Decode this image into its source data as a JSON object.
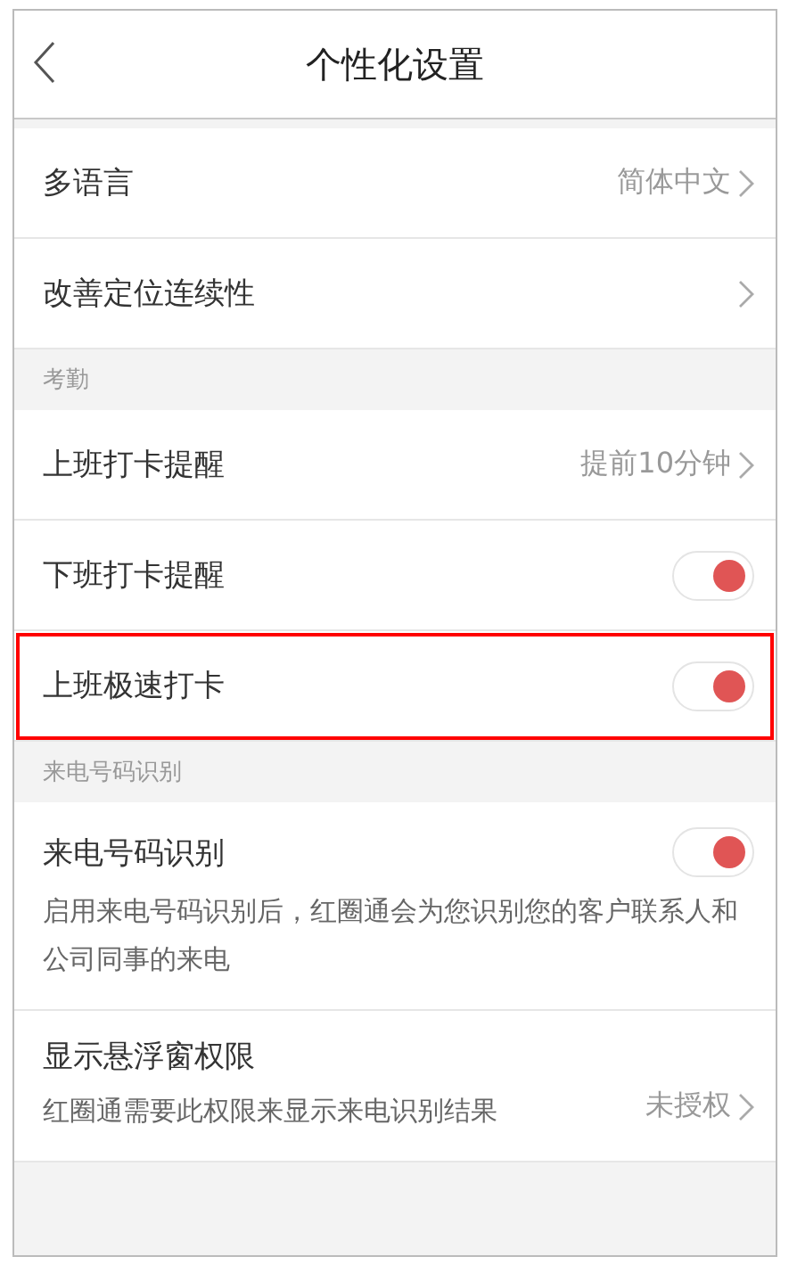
{
  "header": {
    "title": "个性化设置"
  },
  "sections": [
    {
      "items": [
        {
          "kind": "value",
          "label": "多语言",
          "value": "简体中文",
          "highlighted": false
        },
        {
          "kind": "link",
          "label": "改善定位连续性",
          "highlighted": false
        }
      ]
    },
    {
      "title": "考勤",
      "items": [
        {
          "kind": "value",
          "label": "上班打卡提醒",
          "value": "提前10分钟",
          "highlighted": false
        },
        {
          "kind": "toggle",
          "label": "下班打卡提醒",
          "on": true,
          "highlighted": false
        },
        {
          "kind": "toggle",
          "label": "上班极速打卡",
          "on": true,
          "highlighted": true
        }
      ]
    },
    {
      "title": "来电号码识别",
      "items": [
        {
          "kind": "toggle",
          "label": "来电号码识别",
          "on": true,
          "description": "启用来电号码识别后，红圈通会为您识别您的客户联系人和公司同事的来电",
          "highlighted": false
        },
        {
          "kind": "permission",
          "label": "显示悬浮窗权限",
          "description": "红圈通需要此权限来显示来电识别结果",
          "value": "未授权",
          "highlighted": false
        }
      ]
    }
  ]
}
